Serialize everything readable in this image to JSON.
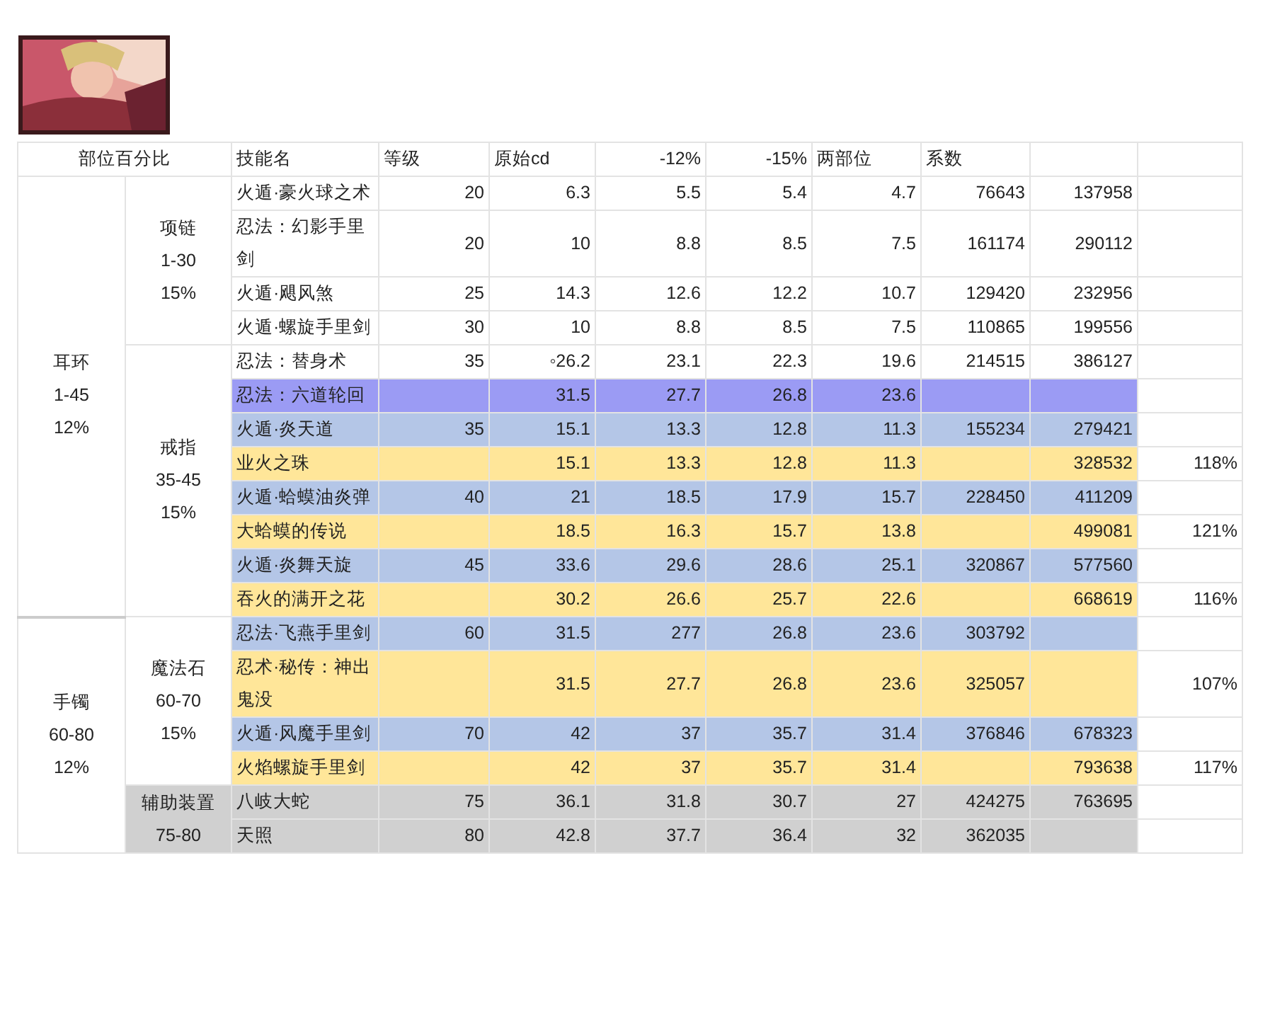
{
  "header": [
    "部位百分比",
    "技能名",
    "等级",
    "原始cd",
    "-12%",
    "-15%",
    "两部位",
    "系数"
  ],
  "groups": [
    {
      "label": "耳环\n1-45\n12%",
      "subgroups": [
        {
          "label": "项链\n1-30\n15%",
          "rows": [
            {
              "skill": "火遁·豪火球之术",
              "cells": [
                "20",
                "6.3",
                "5.5",
                "5.4",
                "4.7",
                "76643",
                "137958",
                null
              ]
            },
            {
              "skill": "忍法：幻影手里剑",
              "cells": [
                "20",
                "10",
                "8.8",
                "8.5",
                "7.5",
                "161174",
                "290112",
                null
              ]
            },
            {
              "skill": "火遁·飓风煞",
              "cells": [
                "25",
                "14.3",
                "12.6",
                "12.2",
                "10.7",
                "129420",
                "232956",
                null
              ]
            },
            {
              "skill": "火遁·螺旋手里剑",
              "cells": [
                "30",
                "10",
                "8.8",
                "8.5",
                "7.5",
                "110865",
                "199556",
                null
              ]
            }
          ]
        },
        {
          "label": "戒指\n35-45\n15%",
          "rows": [
            {
              "skill": "忍法：替身术",
              "cells": [
                "35",
                "◦26.2",
                "23.1",
                "22.3",
                "19.6",
                "214515",
                "386127",
                null
              ]
            },
            {
              "skill": "忍法：六道轮回",
              "color": "#9b9bf4",
              "cells": [
                null,
                "31.5",
                "27.7",
                "26.8",
                "23.6",
                null,
                null,
                null
              ]
            },
            {
              "skill": "火遁·炎天道",
              "color": "#b4c6e7",
              "cells": [
                "35",
                "15.1",
                "13.3",
                "12.8",
                "11.3",
                "155234",
                "279421",
                null
              ]
            },
            {
              "skill": "业火之珠",
              "color": "#ffe699",
              "cells": [
                null,
                "15.1",
                "13.3",
                "12.8",
                "11.3",
                null,
                "328532",
                "118%"
              ]
            },
            {
              "skill": "火遁·蛤蟆油炎弹",
              "color": "#b4c6e7",
              "cells": [
                "40",
                "21",
                "18.5",
                "17.9",
                "15.7",
                "228450",
                "411209",
                null
              ]
            },
            {
              "skill": "大蛤蟆的传说",
              "color": "#ffe699",
              "cells": [
                null,
                "18.5",
                "16.3",
                "15.7",
                "13.8",
                null,
                "499081",
                "121%"
              ]
            },
            {
              "skill": "火遁·炎舞天旋",
              "color": "#b4c6e7",
              "cells": [
                "45",
                "33.6",
                "29.6",
                "28.6",
                "25.1",
                "320867",
                "577560",
                null
              ]
            },
            {
              "skill": "吞火的满开之花",
              "color": "#ffe699",
              "cells": [
                null,
                "30.2",
                "26.6",
                "25.7",
                "22.6",
                null,
                "668619",
                "116%"
              ]
            }
          ]
        }
      ]
    },
    {
      "label": "手镯\n60-80\n12%",
      "subgroups": [
        {
          "label": "魔法石\n60-70\n15%",
          "rows": [
            {
              "skill": "忍法·飞燕手里剑",
              "color": "#b4c6e7",
              "cells": [
                "60",
                "31.5",
                "277",
                "26.8",
                "23.6",
                "303792",
                null,
                null
              ]
            },
            {
              "skill": "忍术·秘传：神出鬼没",
              "color": "#ffe699",
              "cells": [
                null,
                "31.5",
                "27.7",
                "26.8",
                "23.6",
                "325057",
                null,
                "107%"
              ]
            },
            {
              "skill": "火遁·风魔手里剑",
              "color": "#b4c6e7",
              "cells": [
                "70",
                "42",
                "37",
                "35.7",
                "31.4",
                "376846",
                "678323",
                null
              ]
            },
            {
              "skill": "火焰螺旋手里剑",
              "color": "#ffe699",
              "cells": [
                null,
                "42",
                "37",
                "35.7",
                "31.4",
                null,
                "793638",
                "117%"
              ]
            }
          ]
        },
        {
          "label": "辅助装置\n75-80",
          "color": "#d0d0d0",
          "rows": [
            {
              "skill": "八岐大蛇",
              "color": "#d0d0d0",
              "cells": [
                "75",
                "36.1",
                "31.8",
                "30.7",
                "27",
                "424275",
                "763695",
                null
              ]
            },
            {
              "skill": "天照",
              "color": "#d0d0d0",
              "cells": [
                "80",
                "42.8",
                "37.7",
                "36.4",
                "32",
                "362035",
                null,
                null
              ]
            }
          ]
        }
      ]
    }
  ]
}
